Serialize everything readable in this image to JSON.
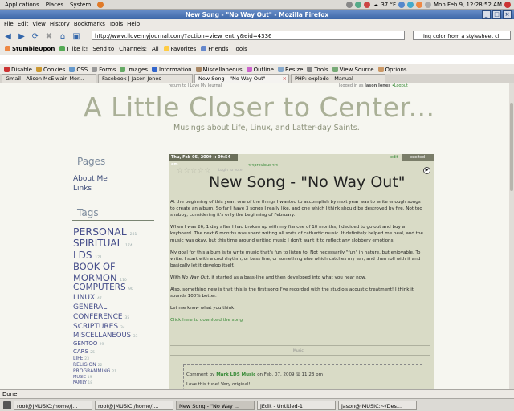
{
  "gnome": {
    "menus": [
      "Applications",
      "Places",
      "System"
    ],
    "weather": "37 °F",
    "clock": "Mon Feb  9, 12:28:52 AM"
  },
  "window": {
    "title": "New Song - \"No Way Out\" - Mozilla Firefox"
  },
  "menubar": [
    "File",
    "Edit",
    "View",
    "History",
    "Bookmarks",
    "Tools",
    "Help"
  ],
  "nav": {
    "url": "http://www.ilovemyjournal.com/?action=view_entry&eid=4336",
    "search": "ing color from a stylesheet cl"
  },
  "toolbar1": [
    "StumbleUpon",
    "I like it!",
    "Send to",
    "Channels:",
    "All",
    "Favorites",
    "Friends",
    "Tools"
  ],
  "toolbar2": [
    "Disable",
    "Cookies",
    "CSS",
    "Forms",
    "Images",
    "Information",
    "Miscellaneous",
    "Outline",
    "Resize",
    "Tools",
    "View Source",
    "Options"
  ],
  "tabs": [
    {
      "label": "Gmail - Alison McElwain Mor..."
    },
    {
      "label": "Facebook | Jason Jones"
    },
    {
      "label": "New Song - \"No Way Out\""
    },
    {
      "label": "PHP: explode - Manual"
    }
  ],
  "page": {
    "return_link": "return to I Love My Journal",
    "logged_in_prefix": "logged in as",
    "logged_in_user": "Jason Jones",
    "logout": "•Logout",
    "title": "A Little Closer to Center...",
    "subtitle": "Musings about Life, Linux, and Latter-day Saints.",
    "pages_heading": "Pages",
    "pages": [
      "About Me",
      "Links"
    ],
    "tags_heading": "Tags",
    "tags": [
      {
        "name": "PERSONAL",
        "count": "281"
      },
      {
        "name": "SPIRITUAL",
        "count": "174"
      },
      {
        "name": "LDS",
        "count": "171"
      },
      {
        "name": "BOOK OF",
        "count": ""
      },
      {
        "name": "MORMON",
        "count": "110"
      },
      {
        "name": "COMPUTERS",
        "count": "90"
      },
      {
        "name": "LINUX",
        "count": "47"
      },
      {
        "name": "GENERAL",
        "count": ""
      },
      {
        "name": "CONFERENCE",
        "count": "35"
      },
      {
        "name": "SCRIPTURES",
        "count": "34"
      },
      {
        "name": "MISCELLANEOUS",
        "count": "33"
      },
      {
        "name": "GENTOO",
        "count": "29"
      },
      {
        "name": "CARS",
        "count": "25"
      },
      {
        "name": "LIFE",
        "count": "23"
      },
      {
        "name": "RELIGION",
        "count": "22"
      },
      {
        "name": "PROGRAMMING",
        "count": "21"
      },
      {
        "name": "MUSIC",
        "count": "19"
      },
      {
        "name": "FAMILY",
        "count": "18"
      }
    ],
    "post": {
      "date": "Thu, Feb 05, 2009 :: 09:54 am",
      "edit": "edit",
      "excited": "excited",
      "previous": "<<previous<<",
      "votes": "Login to vote",
      "title": "New Song - \"No Way Out\"",
      "p1": "At the beginning of this year, one of the things I wanted to accomplish by next year was to write enough songs to create an album.  So far I have 3 songs I really like, and one which I think should be destroyed by fire.  Not too shabby, considering it's only the beginning of February.",
      "p2": "When I was 26, 1 day after I had broken up with my fiancee of 10 months, I decided to go out and buy a keyboard.  The next 6 months was spent writing all sorts of cathartic music.  It definitely helped me heal, and the music was okay, but this time around writing music I don't want it to reflect any slobbery emotions.",
      "p3": "My goal for this album is to write music that's fun to listen to.  Not necessarily \"fun\" in nature, but enjoyable.  To write, I start with a cool rhythm, or bass line, or something else which catches my ear, and then roll with it and basically let it develop itself.",
      "p4_prefix": "With ",
      "p4_italic": "No Way Out",
      "p4_suffix": ", it started as a bass-line and then developed into what you hear now.",
      "p5": "Also, something new is that this is the first song I've recorded with the studio's acoustic treatment!  I think it sounds 100% better.",
      "p6": "Let me know what you think!",
      "download": "Click here to download the song",
      "category": "Music",
      "comment_prefix": "Comment by",
      "comment_author": "Mark LDS Music",
      "comment_date": "on Feb. 07, 2009 @ 11:23 pm",
      "comment_text": "Love this tune!  Very original!"
    }
  },
  "status": "Done",
  "taskbar": [
    {
      "label": "root@JMUSIC:/home/j..."
    },
    {
      "label": "root@JMUSIC:/home/j..."
    },
    {
      "label": "New Song - \"No Way ..."
    },
    {
      "label": "jEdit - Untitled-1"
    },
    {
      "label": "jason@JMUSIC:~/Des..."
    }
  ]
}
